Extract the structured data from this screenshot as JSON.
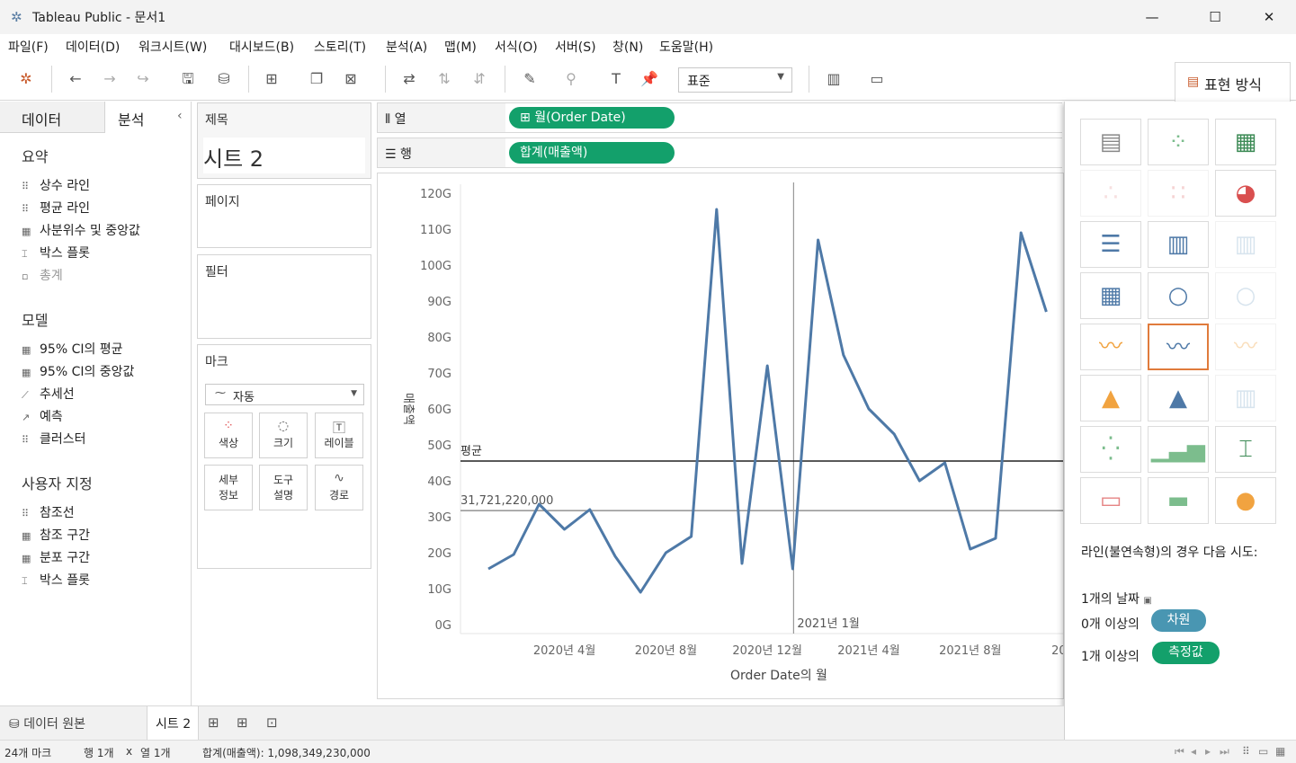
{
  "window": {
    "title": "Tableau Public - 문서1"
  },
  "menu": [
    "파일(F)",
    "데이터(D)",
    "워크시트(W)",
    "대시보드(B)",
    "스토리(T)",
    "분석(A)",
    "맵(M)",
    "서식(O)",
    "서버(S)",
    "창(N)",
    "도움말(H)"
  ],
  "toolbar": {
    "fit_dropdown": "표준",
    "show_me_label": "표현 방식"
  },
  "left_pane": {
    "tab_data": "데이터",
    "tab_analysis": "분석",
    "sections": [
      {
        "title": "요약",
        "items": [
          "상수 라인",
          "평균 라인",
          "사분위수 및 중앙값",
          "박스 플롯",
          "총계"
        ]
      },
      {
        "title": "모델",
        "items": [
          "95% CI의 평균",
          "95% CI의 중앙값",
          "추세선",
          "예측",
          "클러스터"
        ]
      },
      {
        "title": "사용자 지정",
        "items": [
          "참조선",
          "참조 구간",
          "분포 구간",
          "박스 플롯"
        ]
      }
    ]
  },
  "cards": {
    "title_label": "제목",
    "sheet_name": "시트 2",
    "pages_label": "페이지",
    "filters_label": "필터",
    "marks_label": "마크",
    "marks_type": "자동",
    "mark_buttons": [
      "색상",
      "크기",
      "레이블",
      "세부\n정보",
      "도구\n설명",
      "경로"
    ]
  },
  "shelves": {
    "columns_label": "열",
    "rows_label": "행",
    "columns_pill": "월(Order Date)",
    "rows_pill": "합계(매출액)"
  },
  "chart_data": {
    "type": "line",
    "title": "",
    "xlabel": "Order Date의 월",
    "ylabel": "매출액",
    "y_ticks": [
      "0G",
      "10G",
      "20G",
      "30G",
      "40G",
      "50G",
      "60G",
      "70G",
      "80G",
      "90G",
      "100G",
      "110G",
      "120G"
    ],
    "ylim": [
      0,
      120
    ],
    "x_ticks": [
      "2020년 4월",
      "2020년 8월",
      "2020년 12월",
      "2021년 4월",
      "2021년 8월",
      "2021년"
    ],
    "x": [
      "2020-01",
      "2020-02",
      "2020-03",
      "2020-04",
      "2020-05",
      "2020-06",
      "2020-07",
      "2020-08",
      "2020-09",
      "2020-10",
      "2020-11",
      "2020-12",
      "2021-01",
      "2021-02",
      "2021-03",
      "2021-04",
      "2021-05",
      "2021-06",
      "2021-07",
      "2021-08",
      "2021-09",
      "2021-10",
      "2021-11",
      "2021-12"
    ],
    "values": [
      15.5,
      19.5,
      33.5,
      26.5,
      32,
      19,
      9,
      20,
      24.5,
      115.5,
      17,
      72,
      15.5,
      107,
      75,
      60,
      53,
      40,
      45,
      21,
      24,
      109,
      87,
      null
    ],
    "average_line": {
      "label": "평균",
      "value": 45.5
    },
    "reference_line": {
      "label": "31,721,220,000",
      "value": 31.7
    },
    "cursor_label": "2021년 1월",
    "color": "#4e79a7"
  },
  "show_me": {
    "hint_text": "라인(불연속형)의 경우 다음 시도:",
    "req_date": "1개의 날짜",
    "req_dim_prefix": "0개 이상의",
    "req_dim_pill": "차원",
    "req_measure_prefix": "1개 이상의",
    "req_measure_pill": "측정값",
    "dim_color": "#4996b2",
    "measure_color": "#13a06b"
  },
  "bottom_tabs": {
    "data_source": "데이터 원본",
    "sheet": "시트 2"
  },
  "status": {
    "marks": "24개 마크",
    "rows": "행 1개",
    "x": "x",
    "cols": "열 1개",
    "sum": "합계(매출액): 1,098,349,230,000"
  }
}
